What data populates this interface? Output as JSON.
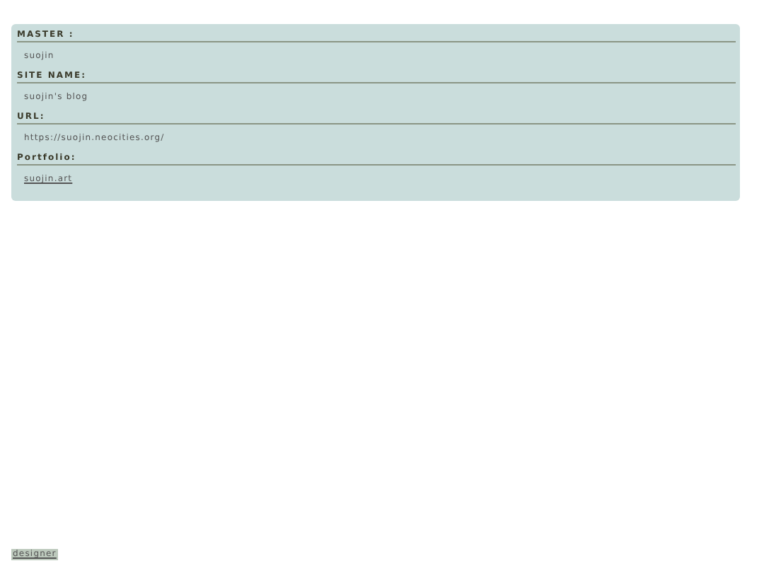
{
  "profile": [
    {
      "label": "MASTER :",
      "value": "suojin",
      "kind": "text"
    },
    {
      "label": "SITE NAME:",
      "value": "suojin's blog",
      "kind": "text"
    },
    {
      "label": "URL:",
      "value": "https://suojin.neocities.org/",
      "kind": "text"
    },
    {
      "label": "Portfolio:",
      "value": "suojin.art",
      "kind": "link"
    }
  ],
  "footer": {
    "link": "designer"
  }
}
